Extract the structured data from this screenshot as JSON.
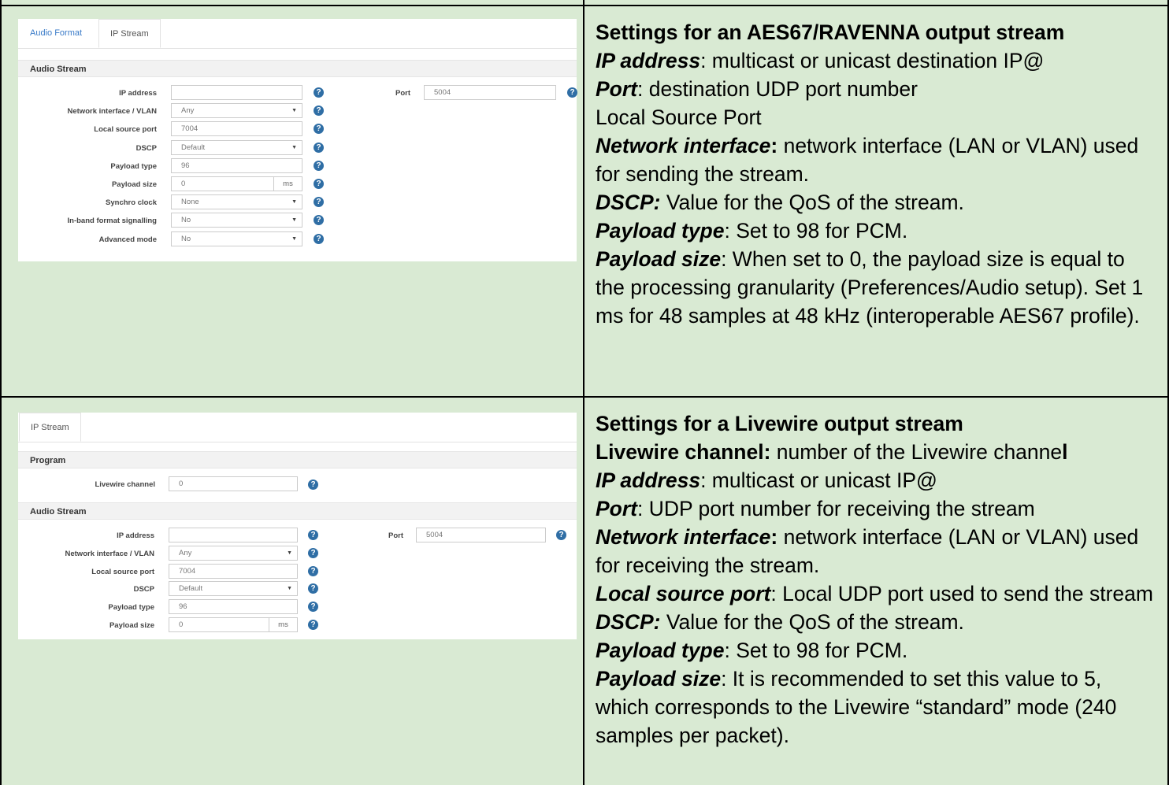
{
  "panel1": {
    "tabs": [
      "Audio Format",
      "IP Stream"
    ],
    "section": "Audio Stream",
    "fields": [
      {
        "label": "IP address",
        "value": "",
        "kind": "text"
      },
      {
        "label": "Network interface / VLAN",
        "value": "Any",
        "kind": "select"
      },
      {
        "label": "Local source port",
        "value": "7004",
        "kind": "text"
      },
      {
        "label": "DSCP",
        "value": "Default",
        "kind": "select"
      },
      {
        "label": "Payload type",
        "value": "96",
        "kind": "text"
      },
      {
        "label": "Payload size",
        "value": "0",
        "kind": "unit",
        "unit": "ms"
      },
      {
        "label": "Synchro clock",
        "value": "None",
        "kind": "select"
      },
      {
        "label": "In-band format signalling",
        "value": "No",
        "kind": "select"
      },
      {
        "label": "Advanced mode",
        "value": "No",
        "kind": "select"
      }
    ],
    "port_label": "Port",
    "port_value": "5004"
  },
  "panel2": {
    "tabs": [
      "IP Stream"
    ],
    "program_section": "Program",
    "livewire_label": "Livewire channel",
    "livewire_value": "0",
    "section": "Audio Stream",
    "fields": [
      {
        "label": "IP address",
        "value": "",
        "kind": "text"
      },
      {
        "label": "Network interface / VLAN",
        "value": "Any",
        "kind": "select"
      },
      {
        "label": "Local source port",
        "value": "7004",
        "kind": "text"
      },
      {
        "label": "DSCP",
        "value": "Default",
        "kind": "select"
      },
      {
        "label": "Payload type",
        "value": "96",
        "kind": "text"
      },
      {
        "label": "Payload size",
        "value": "0",
        "kind": "unit",
        "unit": "ms"
      }
    ],
    "port_label": "Port",
    "port_value": "5004"
  },
  "help_glyph": "?",
  "select_arrow": "▼",
  "desc1": {
    "title": "Settings for an AES67/RAVENNA output stream",
    "lines": [
      [
        {
          "t": "IP address",
          "s": "k"
        },
        {
          "t": ": multicast or unicast destination IP@",
          "s": ""
        }
      ],
      [
        {
          "t": "Port",
          "s": "k"
        },
        {
          "t": ": destination UDP port number",
          "s": ""
        }
      ],
      [
        {
          "t": "Local Source Port",
          "s": ""
        }
      ],
      [
        {
          "t": "Network interface",
          "s": "k"
        },
        {
          "t": ":",
          "s": "b"
        },
        {
          "t": " network interface (LAN or VLAN) used for sending the stream.",
          "s": ""
        }
      ],
      [
        {
          "t": "DSCP:",
          "s": "k"
        },
        {
          "t": " Value for the QoS of the stream.",
          "s": ""
        }
      ],
      [
        {
          "t": "Payload type",
          "s": "k"
        },
        {
          "t": ": Set to 98 for PCM.",
          "s": ""
        }
      ],
      [
        {
          "t": "Payload size",
          "s": "k"
        },
        {
          "t": ": When set to 0, the payload size is equal to the processing granularity (Preferences/Audio setup). Set 1 ms for 48 samples at 48 kHz (interoperable AES67 profile).",
          "s": ""
        }
      ]
    ]
  },
  "desc2": {
    "title": "Settings for a Livewire output stream",
    "lines": [
      [
        {
          "t": "Livewire channe",
          "s": "b"
        },
        {
          "t": "l:",
          "s": "b"
        },
        {
          "t": " number of the Livewire channe",
          "s": ""
        },
        {
          "t": "l",
          "s": "b"
        }
      ],
      [
        {
          "t": "IP address",
          "s": "k"
        },
        {
          "t": ": multicast or unicast IP@",
          "s": ""
        }
      ],
      [
        {
          "t": "Port",
          "s": "k"
        },
        {
          "t": ": UDP port number for receiving the stream",
          "s": ""
        }
      ],
      [
        {
          "t": "Network interface",
          "s": "k"
        },
        {
          "t": ":",
          "s": "b"
        },
        {
          "t": " network interface (LAN or VLAN) used for receiving the stream.",
          "s": ""
        }
      ],
      [
        {
          "t": "Local source port",
          "s": "k"
        },
        {
          "t": ": Local UDP port used to send the stream",
          "s": ""
        }
      ],
      [
        {
          "t": "DSCP:",
          "s": "k"
        },
        {
          "t": " Value for the QoS of the stream.",
          "s": ""
        }
      ],
      [
        {
          "t": "Payload type",
          "s": "k"
        },
        {
          "t": ": Set to 98 for PCM.",
          "s": ""
        }
      ],
      [
        {
          "t": "Payload size",
          "s": "k"
        },
        {
          "t": ": It is recommended to set this value to 5, which corresponds to the Livewire “standard” mode (240 samples per packet).",
          "s": ""
        }
      ]
    ]
  }
}
